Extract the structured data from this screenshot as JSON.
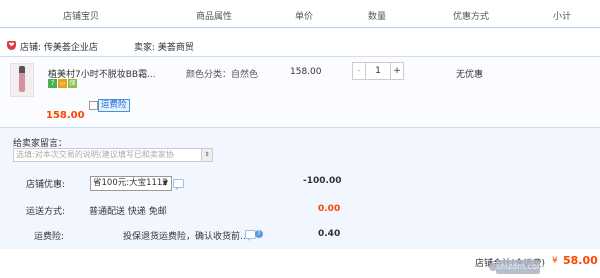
{
  "header": {
    "col_item": "店铺宝贝",
    "col_attr": "商品属性",
    "col_price": "单价",
    "col_qty": "数量",
    "col_promo": "优惠方式",
    "col_subtotal": "小计"
  },
  "shop": {
    "icon": "shop-badge-icon",
    "shop_label": "店铺: 传美荟企业店",
    "seller_label": "卖家: 美荟商贸"
  },
  "item": {
    "title": "植美村7小时不脱妆BB霜...",
    "badges": [
      {
        "icon": "seven-day-return-badge",
        "text": "7",
        "color": "#4caf50"
      },
      {
        "icon": "credit-card-badge",
        "text": "▭",
        "color": "#e8a21a"
      },
      {
        "icon": "guarantee-badge",
        "text": "保",
        "color": "#8bc34a"
      }
    ],
    "attribute": "颜色分类：自然色",
    "unit_price": "158.00",
    "quantity": "1",
    "qty_minus": "-",
    "qty_plus": "+",
    "promo": "无优惠",
    "subtotal": "158.00"
  },
  "panel": {
    "message_label": "给卖家留言：",
    "message_placeholder": "选填:对本次交易的说明(建议填写已和卖家协",
    "coupon_label": "店铺优惠:",
    "coupon_selected": "省100元:大宝1112",
    "coupon_amount": "-100.00",
    "shipping_label": "运送方式:",
    "shipping_text": "普通配送 快递 免邮",
    "shipping_amount": "0.00",
    "insurance_label": "运费险:",
    "insurance_tag": "运费险",
    "insurance_text": "投保退货运费险，确认收货前...",
    "insurance_amount": "0.40"
  },
  "footer": {
    "total_label": "店铺合计(含运费)",
    "currency": "¥",
    "total": "58.00",
    "watermark": "smzdm.com"
  },
  "colors": {
    "accent_orange": "#ff4400",
    "header_border": "#b2d1ff",
    "panel_bg": "#f2f7ff"
  }
}
